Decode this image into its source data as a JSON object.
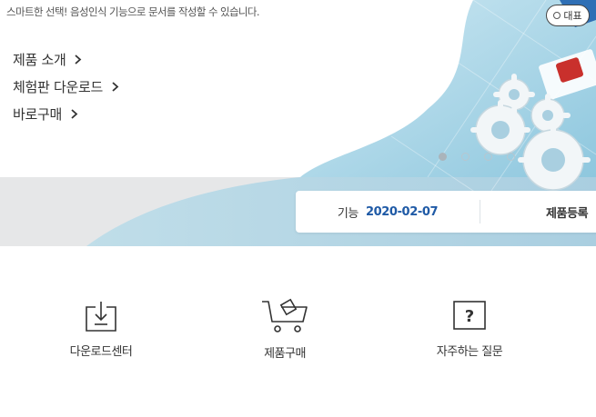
{
  "hero": {
    "subtitle": "스마트한 선택! 음성인식 기능으로 문서를 작성할 수 있습니다.",
    "links": [
      {
        "label": "제품 소개"
      },
      {
        "label": "체험판 다운로드"
      },
      {
        "label": "바로구매"
      }
    ],
    "badge_label": "대표",
    "slides": {
      "count": 4,
      "active_index": 0
    }
  },
  "info_bar": {
    "feature_label": "기능",
    "date": "2020-02-07",
    "register_label": "제품등록"
  },
  "quick_menu": [
    {
      "label": "다운로드센터",
      "icon": "download-tray-icon"
    },
    {
      "label": "제품구매",
      "icon": "shopping-cart-icon"
    },
    {
      "label": "자주하는 질문",
      "icon": "question-box-icon"
    }
  ],
  "colors": {
    "accent_blue": "#1f5aa6",
    "hero_blue_light": "#d5ecf4",
    "hero_blue_mid": "#9fcfe2",
    "band_gray": "#e6e7e8"
  }
}
